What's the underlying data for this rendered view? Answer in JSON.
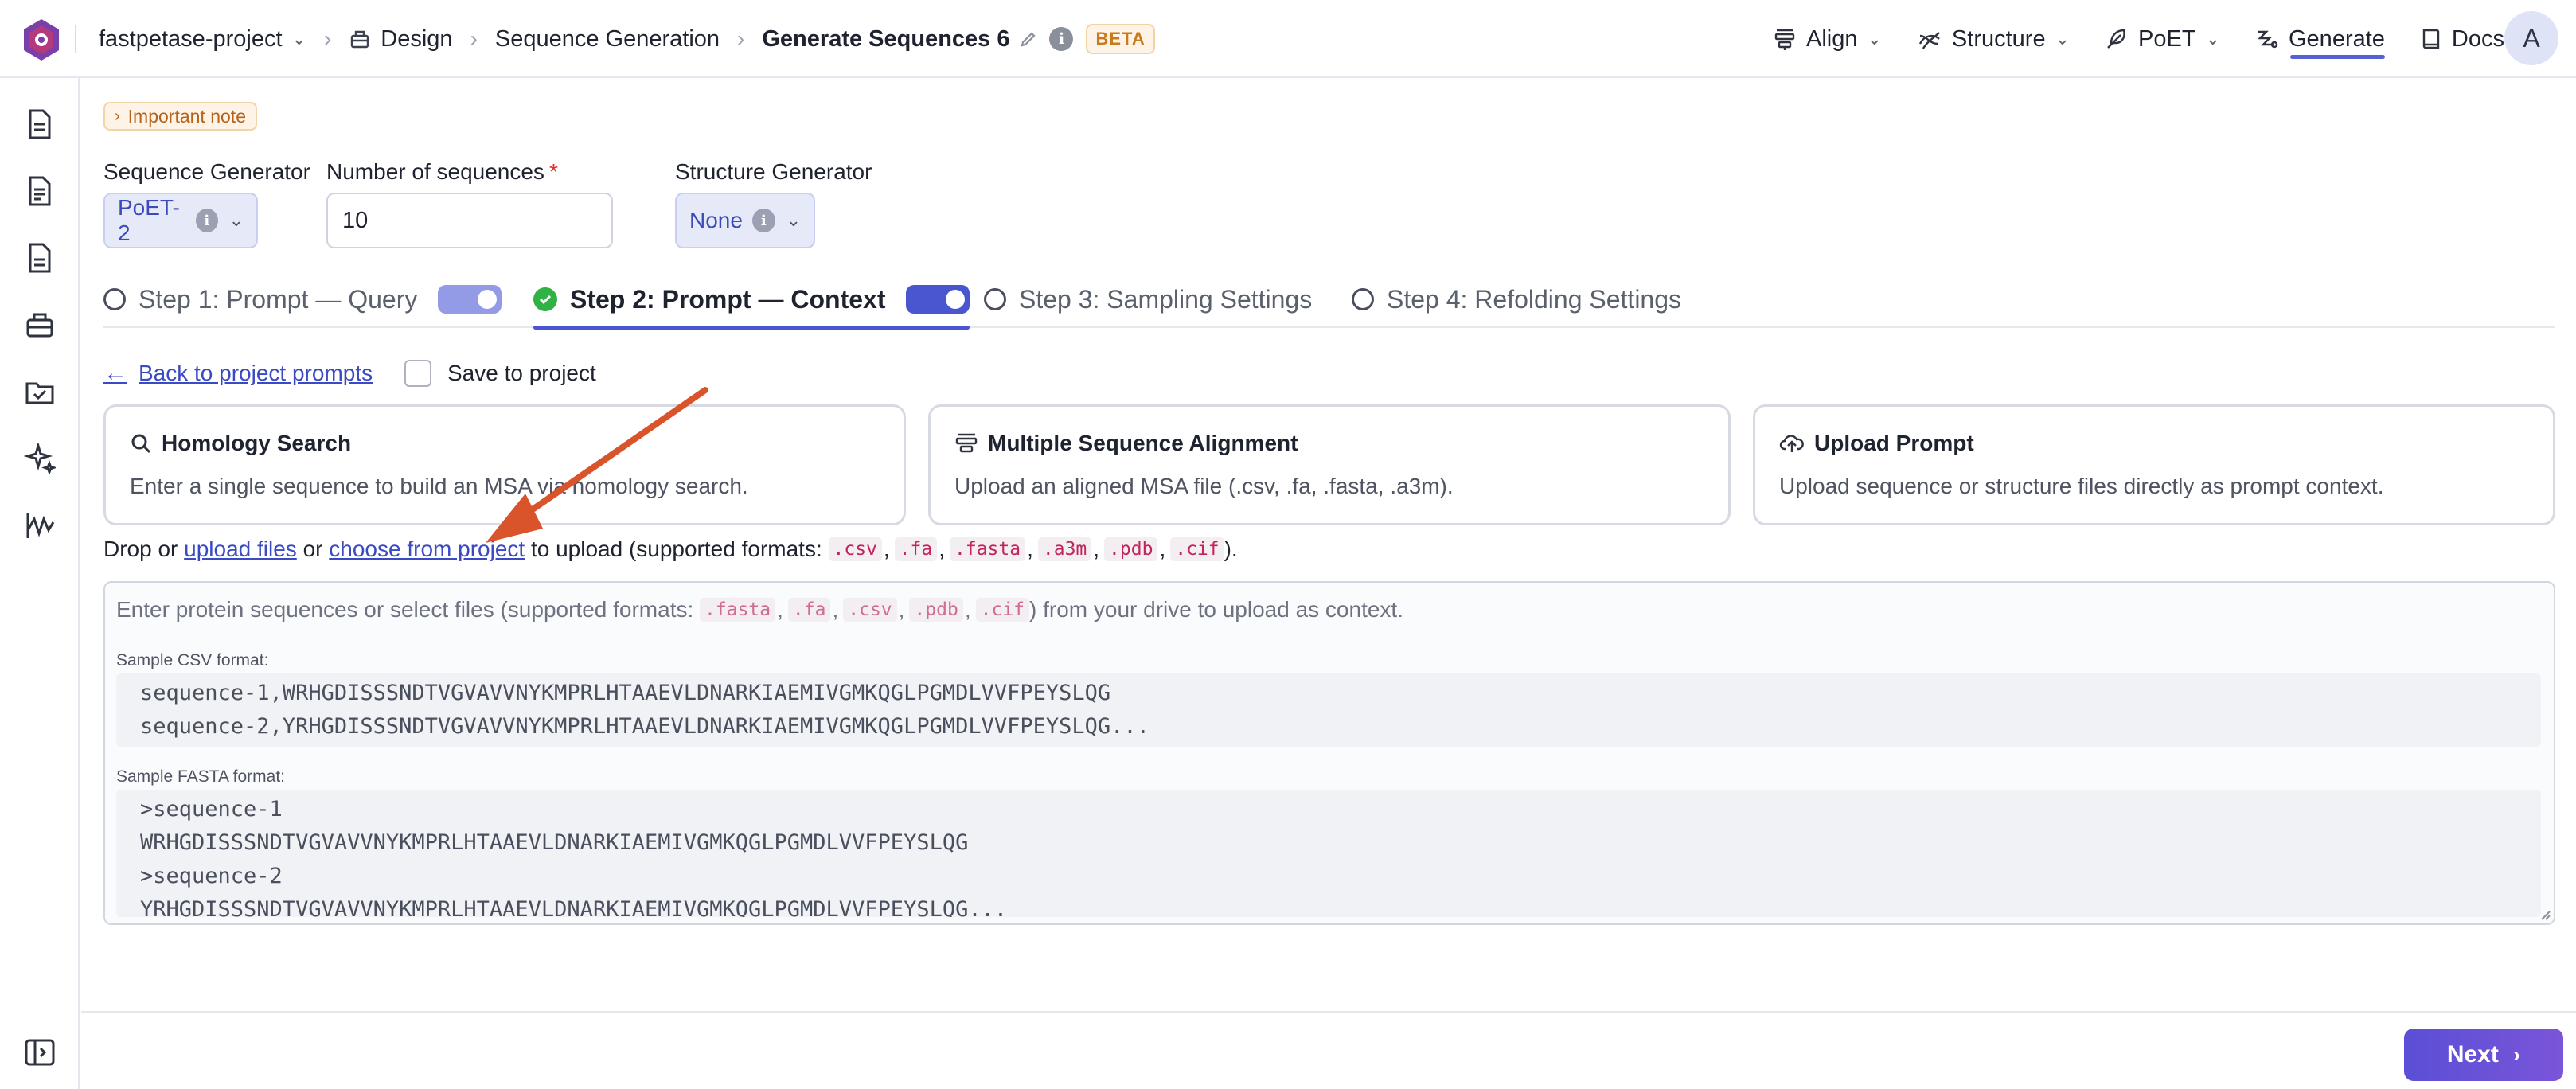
{
  "breadcrumb": {
    "project": "fastpetase-project",
    "section": "Design",
    "subsection": "Sequence Generation",
    "title": "Generate Sequences 6",
    "badge": "BETA"
  },
  "topnav": {
    "items": [
      {
        "label": "Align",
        "icon": "align-icon"
      },
      {
        "label": "Structure",
        "icon": "structure-icon"
      },
      {
        "label": "PoET",
        "icon": "feather-icon"
      },
      {
        "label": "Generate",
        "icon": "generate-icon"
      },
      {
        "label": "Docs",
        "icon": "book-icon"
      }
    ],
    "active": "Generate",
    "avatar_initial": "A"
  },
  "note": {
    "label": "Important note"
  },
  "form": {
    "sequence_generator_label": "Sequence Generator",
    "sequence_generator_value": "PoET-2",
    "num_sequences_label": "Number of sequences",
    "num_sequences_required": "*",
    "num_sequences_value": "10",
    "structure_generator_label": "Structure Generator",
    "structure_generator_value": "None"
  },
  "steps": [
    {
      "label": "Step 1: Prompt — Query",
      "state": "pending"
    },
    {
      "label": "Step 2: Prompt — Context",
      "state": "active"
    },
    {
      "label": "Step 3: Sampling Settings",
      "state": "pending"
    },
    {
      "label": "Step 4: Refolding Settings",
      "state": "pending"
    }
  ],
  "context": {
    "back_label": "Back to project prompts",
    "save_label": "Save to project",
    "cards": [
      {
        "title": "Homology Search",
        "desc": "Enter a single sequence to build an MSA via homology search.",
        "icon": "search-icon"
      },
      {
        "title": "Multiple Sequence Alignment",
        "desc": "Upload an aligned MSA file (.csv, .fa, .fasta, .a3m).",
        "icon": "alignment-icon"
      },
      {
        "title": "Upload Prompt",
        "desc": "Upload sequence or structure files directly as prompt context.",
        "icon": "upload-icon"
      }
    ],
    "drop": {
      "prefix": "Drop or",
      "upload_link": "upload files",
      "or": "or",
      "project_link": "choose from project",
      "suffix": "to upload (supported formats:",
      "formats": [
        ".csv",
        ".fa",
        ".fasta",
        ".a3m",
        ".pdb",
        ".cif"
      ],
      "close": ")."
    },
    "textarea": {
      "placeholder_prefix": "Enter protein sequences or select files (supported formats:",
      "placeholder_formats": [
        ".fasta",
        ".fa",
        ".csv",
        ".pdb",
        ".cif"
      ],
      "placeholder_suffix": ") from your drive to upload as context.",
      "csv_label": "Sample CSV format:",
      "csv_lines": [
        "sequence-1,WRHGDISSSNDTVGVAVVNYKMPRLHTAAEVLDNARKIAEMIVGMKQGLPGMDLVVFPEYSLQG",
        "sequence-2,YRHGDISSSNDTVGVAVVNYKMPRLHTAAEVLDNARKIAEMIVGMKQGLPGMDLVVFPEYSLQG..."
      ],
      "fasta_label": "Sample FASTA format:",
      "fasta_lines": [
        ">sequence-1",
        "WRHGDISSSNDTVGVAVVNYKMPRLHTAAEVLDNARKIAEMIVGMKQGLPGMDLVVFPEYSLQG",
        ">sequence-2",
        "YRHGDISSSNDTVGVAVVNYKMPRLHTAAEVLDNARKIAEMIVGMKQGLPGMDLVVFPEYSLQG..."
      ]
    }
  },
  "footer": {
    "next_label": "Next"
  },
  "colors": {
    "accent": "#4a56d0",
    "link": "#3a49c4",
    "annotation_arrow": "#d9542a",
    "success": "#2fb344"
  }
}
